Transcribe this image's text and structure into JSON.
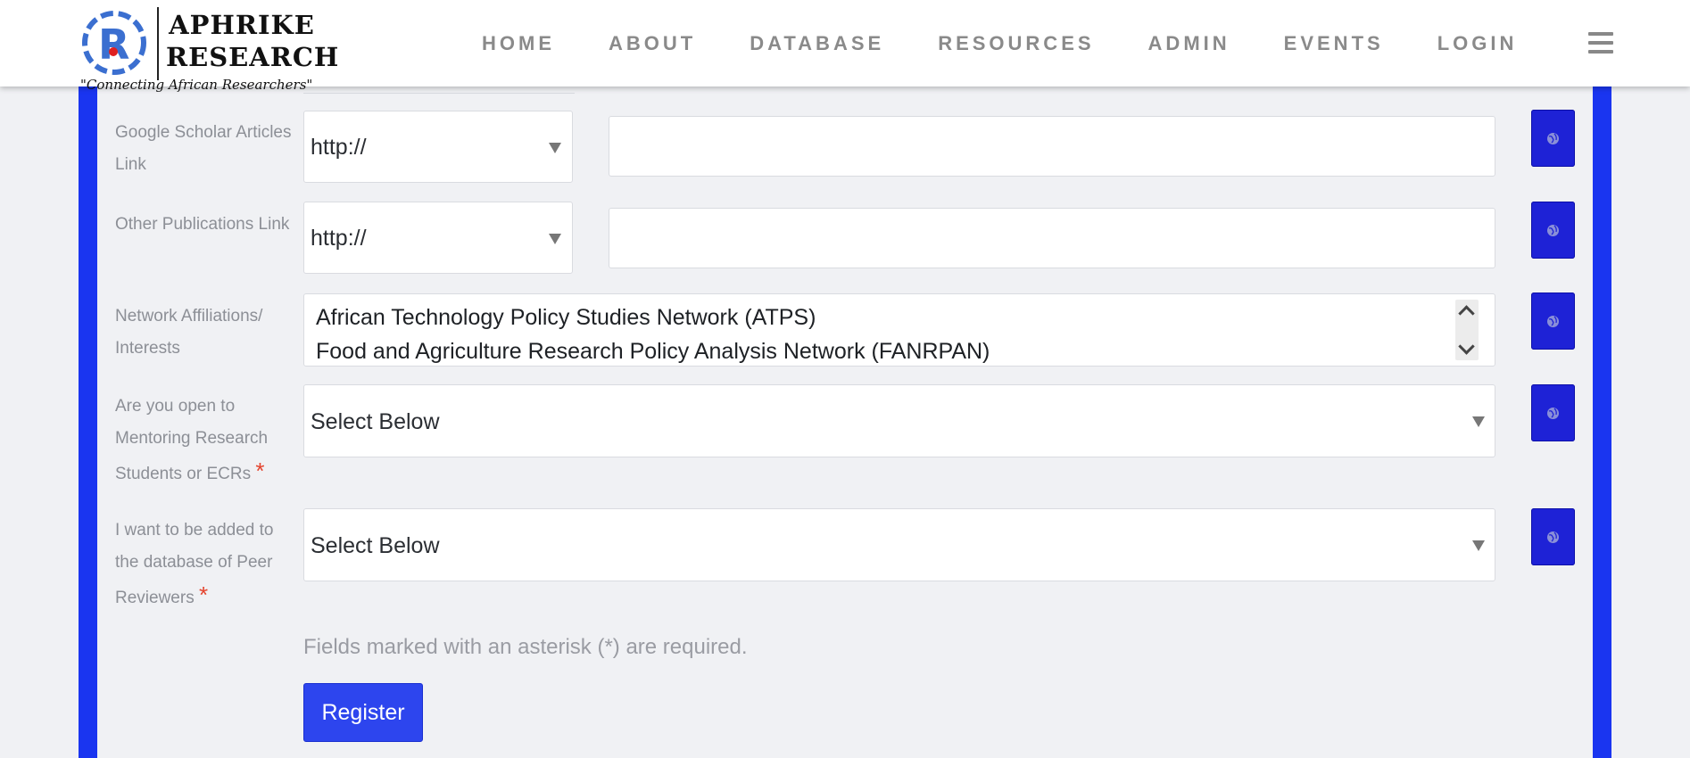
{
  "header": {
    "logo_title_line1": "APHRIKE",
    "logo_title_line2": "RESEARCH",
    "logo_tagline": "\"Connecting African Researchers\"",
    "nav": [
      {
        "label": "HOME"
      },
      {
        "label": "ABOUT"
      },
      {
        "label": "DATABASE"
      },
      {
        "label": "RESOURCES"
      },
      {
        "label": "ADMIN"
      },
      {
        "label": "EVENTS"
      },
      {
        "label": "LOGIN"
      }
    ]
  },
  "form": {
    "google_scholar": {
      "label": "Google Scholar Articles Link",
      "protocol": "http://",
      "value": ""
    },
    "other_publications": {
      "label": "Other Publications Link",
      "protocol": "http://",
      "value": ""
    },
    "network": {
      "label": "Network Affiliations/ Interests",
      "options": [
        "African Technology Policy Studies Network (ATPS)",
        "Food and Agriculture Research Policy Analysis Network (FANRPAN)"
      ]
    },
    "mentoring": {
      "label": "Are you open to Mentoring Research Students or ECRs",
      "required_mark": "*",
      "selected": "Select Below"
    },
    "peer_reviewers": {
      "label": "I want to be added to the database of Peer Reviewers",
      "required_mark": "*",
      "selected": "Select Below"
    },
    "note": "Fields marked with an asterisk (*) are required.",
    "submit_label": "Register"
  },
  "icons": {
    "visibility_button_icon": "globe-icon",
    "menu_icon": "hamburger-icon"
  },
  "colors": {
    "frame_blue": "#1a35f0",
    "button_blue": "#1e22d6",
    "register_blue": "#2d45ee",
    "required_red": "#e4432d"
  }
}
